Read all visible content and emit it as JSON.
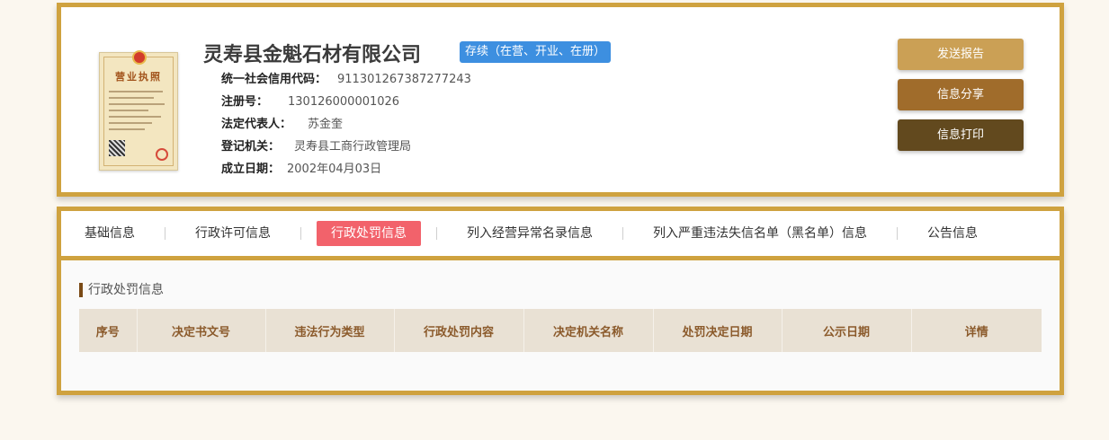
{
  "company": {
    "name": "灵寿县金魁石材有限公司",
    "status": "存续（在营、开业、在册）",
    "license_thumbnail_title": "营业执照"
  },
  "info": [
    {
      "label": "统一社会信用代码：",
      "value": "911301267387277243"
    },
    {
      "label": "注册号：",
      "value": "130126000001026"
    },
    {
      "label": "法定代表人：",
      "value": "苏金奎"
    },
    {
      "label": "登记机关：",
      "value": "灵寿县工商行政管理局"
    },
    {
      "label": "成立日期：",
      "value": "2002年04月03日"
    }
  ],
  "actions": {
    "send_report": "发送报告",
    "share": "信息分享",
    "print": "信息打印"
  },
  "tabs": [
    {
      "label": "基础信息",
      "active": false
    },
    {
      "label": "行政许可信息",
      "active": false
    },
    {
      "label": "行政处罚信息",
      "active": true
    },
    {
      "label": "列入经营异常名录信息",
      "active": false
    },
    {
      "label": "列入严重违法失信名单（黑名单）信息",
      "active": false
    },
    {
      "label": "公告信息",
      "active": false
    }
  ],
  "section": {
    "title": "行政处罚信息",
    "columns": [
      "序号",
      "决定书文号",
      "违法行为类型",
      "行政处罚内容",
      "决定机关名称",
      "处罚决定日期",
      "公示日期",
      "详情"
    ]
  },
  "colors": {
    "border_gold": "#cfa23f",
    "badge_blue": "#3d8fe0",
    "tab_active": "#f2626b",
    "btn_report": "#cba055",
    "btn_share": "#a06c2b",
    "btn_print": "#62491e"
  }
}
